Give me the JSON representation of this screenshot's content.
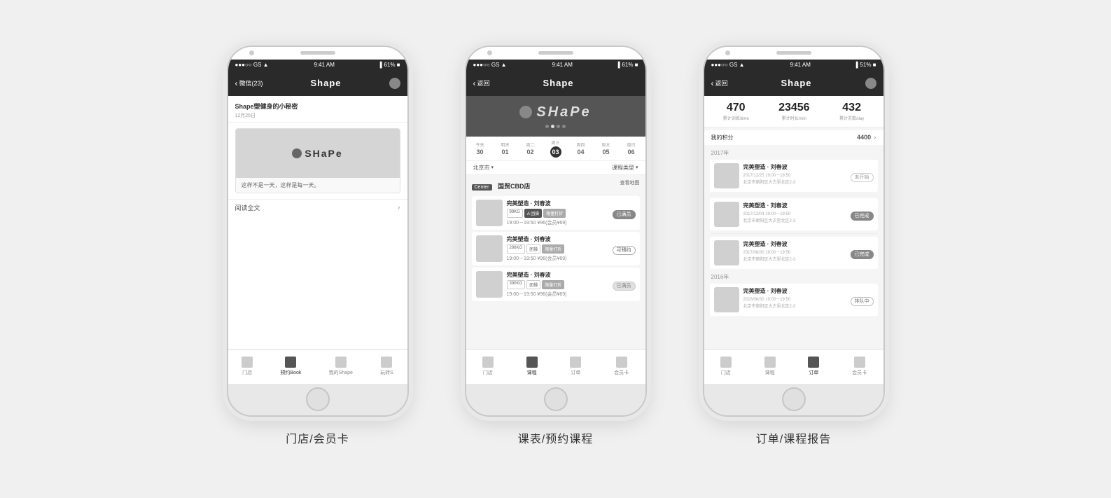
{
  "page": {
    "background": "#f0f0f0"
  },
  "phones": [
    {
      "id": "phone1",
      "label": "门店/会员卡",
      "status_bar": {
        "left": "●●●○○ GS ▲",
        "center": "9:41 AM",
        "right": "▌61% ■"
      },
      "nav": {
        "back_text": "微信(23)",
        "title": "Shape",
        "has_avatar": true
      },
      "message": {
        "title": "Shape塑健身的小秘密",
        "date": "12月25日"
      },
      "card_text": "这样不是一天，这样是每一天。",
      "read_more": "阅读全文",
      "tabs": [
        "门店",
        "预约Book",
        "我的Shape",
        "玩转S"
      ]
    },
    {
      "id": "phone2",
      "label": "课表/预约课程",
      "status_bar": {
        "left": "●●●○○ GS ▲",
        "center": "9:41 AM",
        "right": "▌61% ■"
      },
      "nav": {
        "back_text": "返回",
        "title": "Shape"
      },
      "dates": [
        {
          "day": "今天",
          "num": "30",
          "active": false
        },
        {
          "day": "明天",
          "num": "01",
          "active": false
        },
        {
          "day": "周二",
          "num": "02",
          "active": false
        },
        {
          "day": "周三",
          "num": "03",
          "active": true
        },
        {
          "day": "周四",
          "num": "04",
          "active": false
        },
        {
          "day": "周五",
          "num": "05",
          "active": false
        },
        {
          "day": "周日",
          "num": "06",
          "active": false
        }
      ],
      "filter": {
        "city": "北京市",
        "type": "课程类型"
      },
      "center": {
        "tag": "Center",
        "name": "国贸CBD店",
        "map_link": "查看地图"
      },
      "courses": [
        {
          "title": "完美塑造 · 刘春波",
          "tags": [
            "99KG",
            "A 团操",
            "限量打折"
          ],
          "time": "19:00－19:50  ¥96(会员¥69)",
          "status": "已满员",
          "status_type": "full"
        },
        {
          "title": "完美塑造 · 刘春波",
          "tags": [
            "286KG",
            "团操",
            "限量打折"
          ],
          "time": "19:00－19:50  ¥96(会员¥69)",
          "status": "可预约",
          "status_type": "available"
        },
        {
          "title": "完美塑造 · 刘春波",
          "tags": [
            "390KG",
            "团操",
            "限量打折"
          ],
          "time": "19:00－19:50  ¥96(会员¥69)",
          "status": "已满员",
          "status_type": "full"
        }
      ],
      "tabs": [
        "门店",
        "课程",
        "订单",
        "会员卡"
      ],
      "active_tab": "课程"
    },
    {
      "id": "phone3",
      "label": "订单/课程报告",
      "status_bar": {
        "left": "●●●○○ GS ▲",
        "center": "9:41 AM",
        "right": "▌51% ■"
      },
      "nav": {
        "back_text": "返回",
        "title": "Shape",
        "has_avatar": true
      },
      "stats": [
        {
          "num": "470",
          "label": "累计训练/time"
        },
        {
          "num": "23456",
          "label": "累计时长/min"
        },
        {
          "num": "432",
          "label": "累计天数/day"
        }
      ],
      "points": {
        "label": "我的积分",
        "value": "4400",
        "arrow": "›"
      },
      "years": [
        {
          "year": "2017年",
          "orders": [
            {
              "title": "完美塑造 · 刘春波",
              "time": "2017/12/25 19:00－19:50",
              "location": "北京市朝阳区大古里北区2-3",
              "status": "未开始",
              "status_type": "not-started"
            },
            {
              "title": "完美塑造 · 刘春波",
              "time": "2017/12/04 19:00－19:50",
              "location": "北京市朝阳区大古里北区2-3",
              "status": "已完成",
              "status_type": "done"
            },
            {
              "title": "完美塑造 · 刘春波",
              "time": "2017/06/30 19:00－19:50",
              "location": "北京市朝阳区大古里北区2-3",
              "status": "已完成",
              "status_type": "done"
            }
          ]
        },
        {
          "year": "2016年",
          "orders": [
            {
              "title": "完美塑造 · 刘春波",
              "time": "2016/06/30 19:00－19:50",
              "location": "北京市朝阳区大古里北区2-3",
              "status": "排队中",
              "status_type": "queue"
            }
          ]
        }
      ],
      "tabs": [
        "门店",
        "课程",
        "订单",
        "会员卡"
      ],
      "active_tab": "订单"
    }
  ]
}
